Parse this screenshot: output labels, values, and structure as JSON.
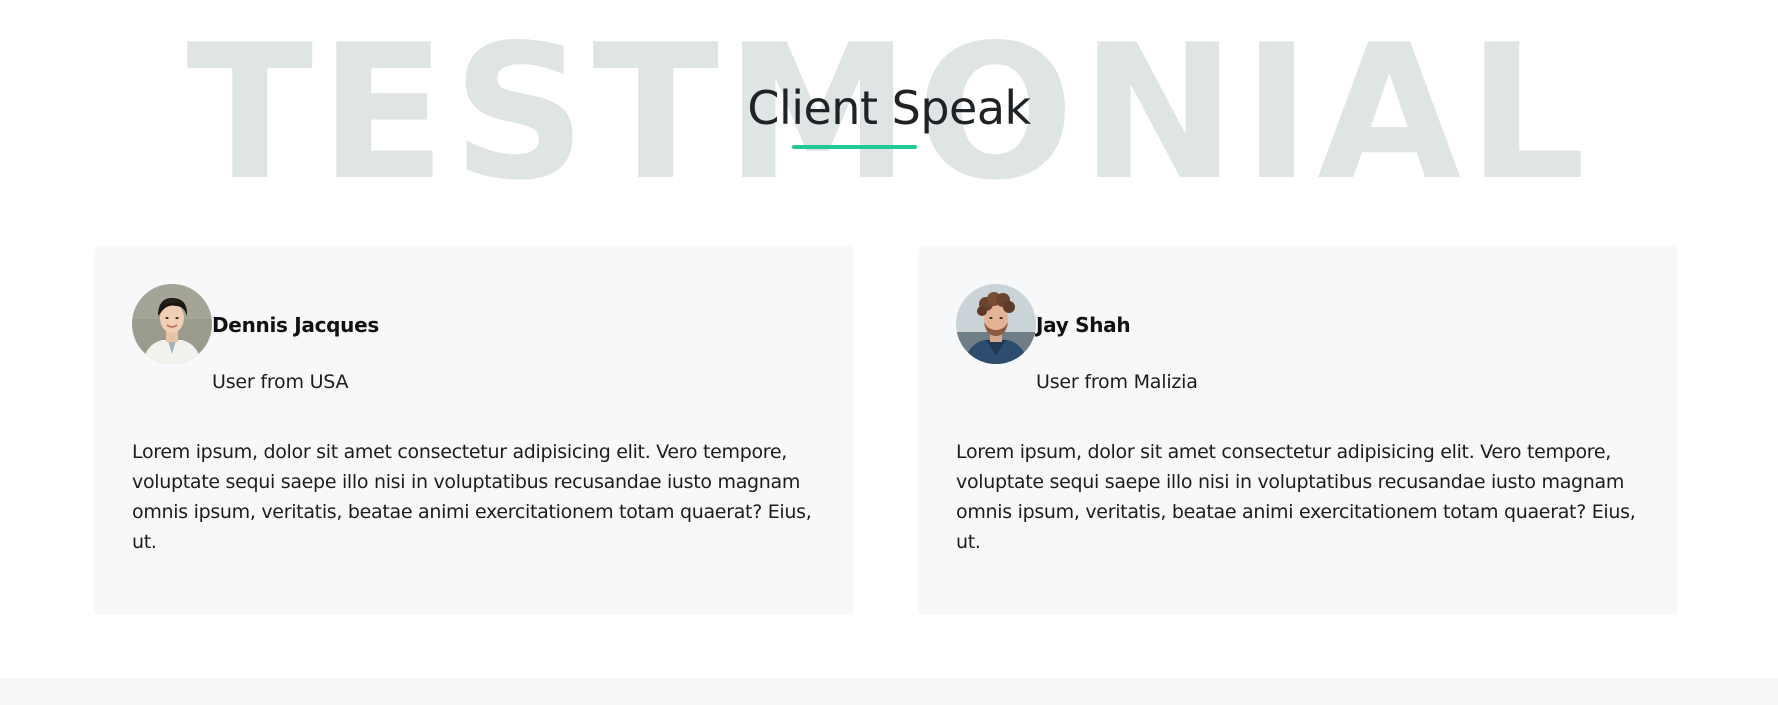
{
  "section": {
    "background_word": "TESTMONIAL",
    "title": "Client Speak",
    "accent_color": "#20c997"
  },
  "testimonials": [
    {
      "name": "Dennis Jacques",
      "role": "User from USA",
      "avatar_icon": "avatar-photo",
      "quote": "Lorem ipsum, dolor sit amet consectetur adipisicing elit. Vero tempore, voluptate sequi saepe illo nisi in voluptatibus recusandae iusto magnam omnis ipsum, veritatis, beatae animi exercitationem totam quaerat? Eius, ut."
    },
    {
      "name": "Jay Shah",
      "role": "User from Malizia",
      "avatar_icon": "avatar-photo",
      "quote": "Lorem ipsum, dolor sit amet consectetur adipisicing elit. Vero tempore, voluptate sequi saepe illo nisi in voluptatibus recusandae iusto magnam omnis ipsum, veritatis, beatae animi exercitationem totam quaerat? Eius, ut."
    }
  ]
}
